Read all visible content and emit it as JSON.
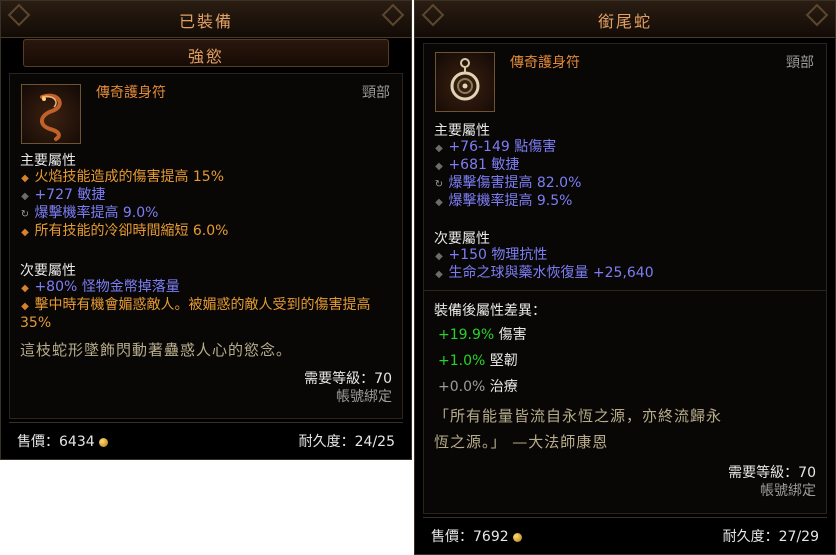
{
  "left": {
    "header_title": "已裝備",
    "name": "強慾",
    "item_type": "傳奇護身符",
    "slot": "頸部",
    "primary_title": "主要屬性",
    "primary": [
      {
        "text": "火焰技能造成的傷害提高 15%",
        "color": "orange",
        "bullet": "orange"
      },
      {
        "text": "+727 敏捷",
        "color": "blue",
        "bullet": "gray"
      },
      {
        "text": "爆擊機率提高 9.0%",
        "color": "blue",
        "bullet": "ring"
      },
      {
        "text": "所有技能的冷卻時間縮短 6.0%",
        "color": "orange",
        "bullet": "orange"
      }
    ],
    "secondary_title": "次要屬性",
    "secondary": [
      {
        "text": "+80% 怪物金幣掉落量",
        "color": "blue",
        "bullet": "orange"
      },
      {
        "text": "擊中時有機會媚惑敵人。被媚惑的敵人受到的傷害提高",
        "color": "orange",
        "bullet": "orange"
      },
      {
        "text": "35%",
        "color": "orange",
        "bullet": "none"
      }
    ],
    "flavor": "這枝蛇形墜飾閃動著蠱惑人心的慾念。",
    "required_level": "需要等級：70",
    "bound": "帳號綁定",
    "price_label": "售價：",
    "price": "6434",
    "durability": "耐久度：24/25"
  },
  "right": {
    "header_title": "銜尾蛇",
    "item_type": "傳奇護身符",
    "slot": "頸部",
    "primary_title": "主要屬性",
    "primary": [
      {
        "text": "+76-149 點傷害",
        "color": "blue",
        "bullet": "gray"
      },
      {
        "text": "+681 敏捷",
        "color": "blue",
        "bullet": "gray"
      },
      {
        "text": "爆擊傷害提高 82.0%",
        "color": "blue",
        "bullet": "ring"
      },
      {
        "text": "爆擊機率提高 9.5%",
        "color": "blue",
        "bullet": "gray"
      }
    ],
    "secondary_title": "次要屬性",
    "secondary": [
      {
        "text": "+150 物理抗性",
        "color": "blue",
        "bullet": "gray"
      },
      {
        "text": "生命之球與藥水恢復量 +25,640",
        "color": "blue",
        "bullet": "gray"
      }
    ],
    "diff_title": "裝備後屬性差異：",
    "diff": [
      {
        "value": "+19.9%",
        "label": "傷害",
        "color": "green"
      },
      {
        "value": "+1.0%",
        "label": "堅韌",
        "color": "green"
      },
      {
        "value": "+0.0%",
        "label": "治療",
        "color": "gray"
      }
    ],
    "flavor_line1": "「所有能量皆流自永恆之源，亦終流歸永",
    "flavor_line2": "恆之源。」 —大法師康恩",
    "required_level": "需要等級：70",
    "bound": "帳號綁定",
    "price_label": "售價：",
    "price": "7692",
    "durability": "耐久度：27/29"
  }
}
